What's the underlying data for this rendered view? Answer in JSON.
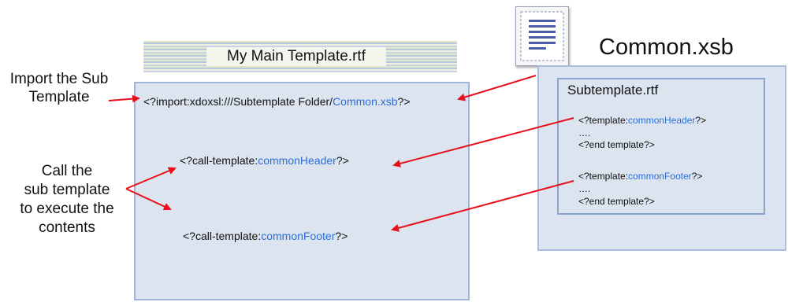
{
  "main_template": {
    "title": "My Main Template.rtf",
    "import_prefix": "<?import:xdoxsl:///Subtemplate Folder/",
    "import_file": "Common.xsb",
    "import_suffix": "?>",
    "call_header_prefix": "<?call-template:",
    "call_header_name": "commonHeader",
    "call_header_suffix": "?>",
    "call_footer_prefix": "<?call-template:",
    "call_footer_name": "commonFooter",
    "call_footer_suffix": "?>"
  },
  "annotations": {
    "import_line1": "Import the Sub",
    "import_line2": "Template",
    "call_line1": "Call the",
    "call_line2": "sub template",
    "call_line3": "to execute the",
    "call_line4": "contents"
  },
  "common_file": {
    "title": "Common.xsb",
    "icon": "document-icon",
    "subtemplate_title": "Subtemplate.rtf",
    "header_prefix": "<?template:",
    "header_name": "commonHeader",
    "header_suffix": "?>",
    "header_dots": "….",
    "header_end": "<?end template?>",
    "footer_prefix": "<?template:",
    "footer_name": "commonFooter",
    "footer_suffix": "?>",
    "footer_dots": "….",
    "footer_end": "<?end template?>"
  },
  "colors": {
    "arrow": "#e8101a",
    "panel_fill": "#dce4ef",
    "panel_border": "#9fb5d8",
    "highlight_text": "#2c6ed6"
  }
}
